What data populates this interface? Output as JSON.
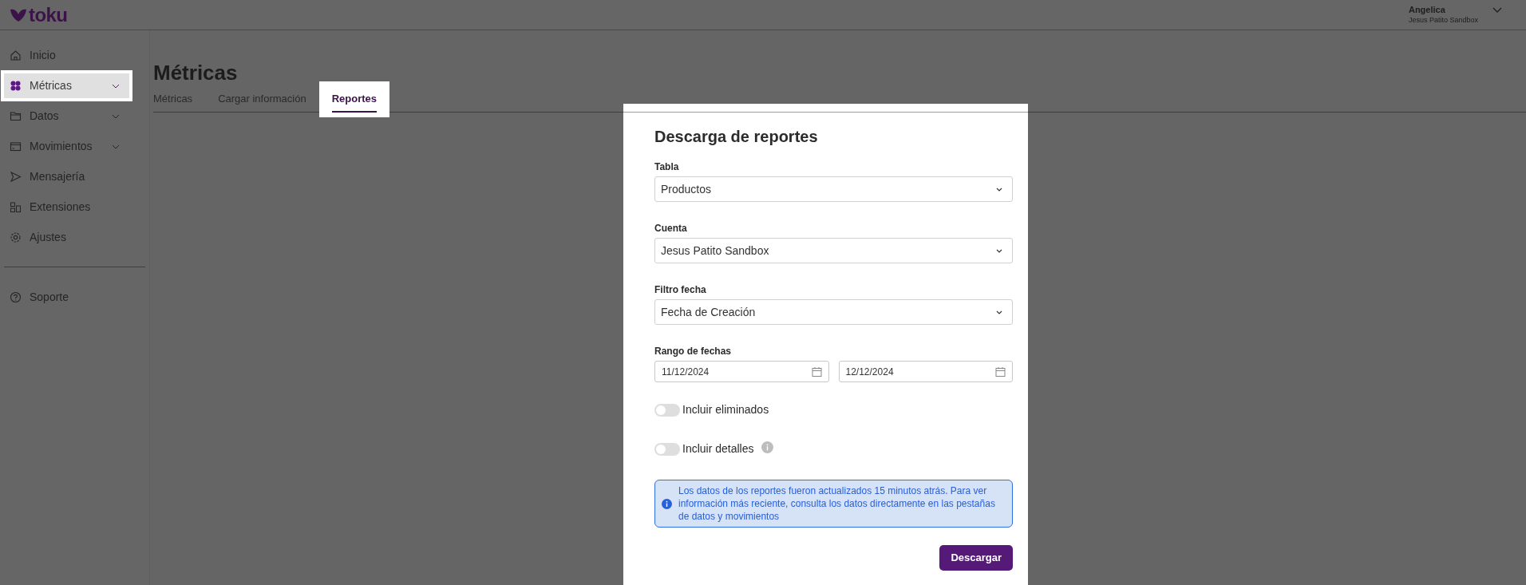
{
  "brand": "toku",
  "user": {
    "name": "Angelica",
    "account": "Jesus Patito Sandbox"
  },
  "sidebar": {
    "items": [
      {
        "label": "Inicio",
        "expandable": false,
        "selected": false
      },
      {
        "label": "Métricas",
        "expandable": true,
        "selected": true
      },
      {
        "label": "Datos",
        "expandable": true,
        "selected": false
      },
      {
        "label": "Movimientos",
        "expandable": true,
        "selected": false
      },
      {
        "label": "Mensajería",
        "expandable": false,
        "selected": false
      },
      {
        "label": "Extensiones",
        "expandable": false,
        "selected": false
      },
      {
        "label": "Ajustes",
        "expandable": false,
        "selected": false
      }
    ],
    "footer_items": [
      {
        "label": "Soporte",
        "expandable": false,
        "selected": false
      }
    ]
  },
  "page": {
    "title": "Métricas",
    "tabs": [
      {
        "label": "Métricas",
        "selected": false
      },
      {
        "label": "Cargar información",
        "selected": false
      },
      {
        "label": "Reportes",
        "selected": true
      }
    ]
  },
  "modal": {
    "title": "Descarga de reportes",
    "selects": [
      {
        "label": "Tabla",
        "value": "Productos"
      },
      {
        "label": "Cuenta",
        "value": "Jesus Patito Sandbox"
      },
      {
        "label": "Filtro fecha",
        "value": "Fecha de Creación"
      }
    ],
    "date_range": {
      "label": "Rango de fechas",
      "from": "11/12/2024",
      "to": "12/12/2024"
    },
    "toggles": [
      {
        "label": "Incluir eliminados",
        "on": false,
        "info": false
      },
      {
        "label": "Incluir detalles",
        "on": false,
        "info": true
      }
    ],
    "notice": "Los datos de los reportes fueron actualizados 15 minutos atrás. Para ver información más reciente, consulta los datos directamente en las pestañas de datos y movimientos",
    "button": "Descargar"
  }
}
